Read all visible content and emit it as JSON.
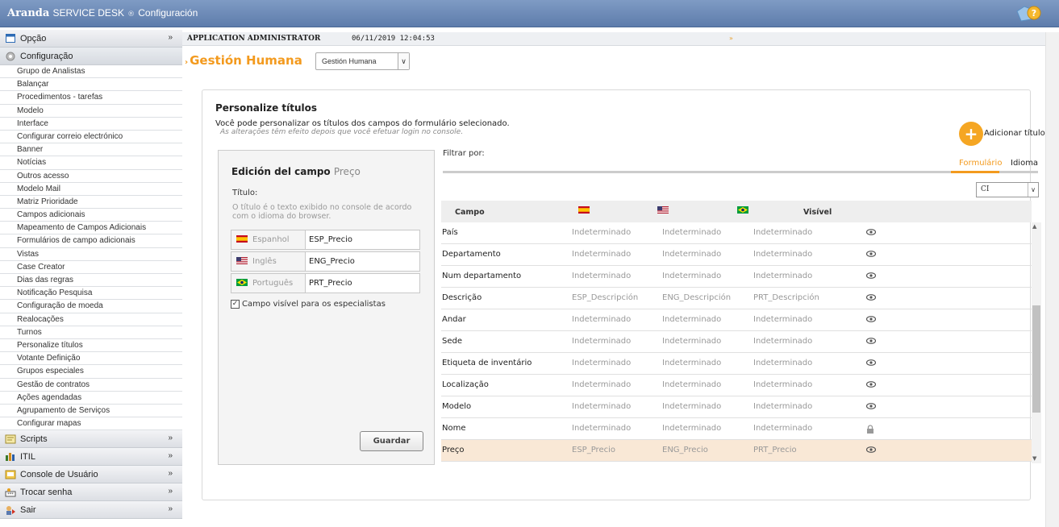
{
  "app": {
    "brand_bold": "Aranda",
    "brand_product": "SERVICE DESK",
    "brand_mark": "®",
    "brand_section": "Configuración"
  },
  "sidebar": {
    "opcao": "Opção",
    "configuracao": "Configuração",
    "items": [
      "Grupo de Analistas",
      "Balançar",
      "Procedimentos - tarefas",
      "Modelo",
      "Interface",
      "Configurar correio electrónico",
      "Banner",
      "Notícias",
      "Outros acesso",
      "Modelo Mail",
      "Matriz Prioridade",
      "Campos adicionais",
      "Mapeamento de Campos Adicionais",
      "Formulários de campo adicionais",
      "Vistas",
      "Case Creator",
      "Dias das regras",
      "Notificação Pesquisa",
      "Configuração de moeda",
      "Realocações",
      "Turnos",
      "Personalize títulos",
      "Votante Definição",
      "Grupos especiales",
      "Gestão de contratos",
      "Ações agendadas",
      "Agrupamento de Serviços",
      "Configurar mapas"
    ],
    "bottom": [
      "Scripts",
      "ITIL",
      "Console de Usuário",
      "Trocar senha",
      "Sair"
    ]
  },
  "header": {
    "user": "APPLICATION ADMINISTRATOR",
    "datetime": "06/11/2019 12:04:53",
    "arrow": "»"
  },
  "page": {
    "title_prefix": "›",
    "title": "Gestión Humana",
    "select_value": "Gestión Humana"
  },
  "card": {
    "title": "Personalize títulos",
    "desc": "Você pode personalizar os títulos dos campos do formulário selecionado.",
    "note": "As alterações têm efeito depois que você efetuar login no console."
  },
  "edit": {
    "title": "Edición del campo",
    "field": "Preço",
    "titulo_label": "Título:",
    "titulo_help": "O título é o texto exibido no console de acordo com o idioma do browser.",
    "langs": [
      {
        "name": "Espanhol",
        "value": "ESP_Precio"
      },
      {
        "name": "Inglês",
        "value": "ENG_Precio"
      },
      {
        "name": "Português",
        "value": "PRT_Precio"
      }
    ],
    "visible_label": "Campo visível para os especialistas",
    "save": "Guardar"
  },
  "filter": {
    "label": "Filtrar por:",
    "add_label": "Adicionar título",
    "tab_form": "Formulário",
    "tab_idioma": "Idioma",
    "select_value": "CI"
  },
  "table": {
    "headers": {
      "campo": "Campo",
      "visivel": "Visível"
    },
    "rows": [
      {
        "campo": "País",
        "es": "Indeterminado",
        "en": "Indeterminado",
        "pt": "Indeterminado",
        "icon": "eye",
        "mark": false,
        "sel": false
      },
      {
        "campo": "Departamento",
        "es": "Indeterminado",
        "en": "Indeterminado",
        "pt": "Indeterminado",
        "icon": "eye",
        "mark": false,
        "sel": false
      },
      {
        "campo": "Num departamento",
        "es": "Indeterminado",
        "en": "Indeterminado",
        "pt": "Indeterminado",
        "icon": "eye",
        "mark": false,
        "sel": false
      },
      {
        "campo": "Descrição",
        "es": "ESP_Descripción",
        "en": "ENG_Descripción",
        "pt": "PRT_Descripción",
        "icon": "eye",
        "mark": true,
        "sel": false
      },
      {
        "campo": "Andar",
        "es": "Indeterminado",
        "en": "Indeterminado",
        "pt": "Indeterminado",
        "icon": "eye",
        "mark": false,
        "sel": false
      },
      {
        "campo": "Sede",
        "es": "Indeterminado",
        "en": "Indeterminado",
        "pt": "Indeterminado",
        "icon": "eye",
        "mark": false,
        "sel": false
      },
      {
        "campo": "Etiqueta de inventário",
        "es": "Indeterminado",
        "en": "Indeterminado",
        "pt": "Indeterminado",
        "icon": "eye",
        "mark": false,
        "sel": false
      },
      {
        "campo": "Localização",
        "es": "Indeterminado",
        "en": "Indeterminado",
        "pt": "Indeterminado",
        "icon": "eye",
        "mark": false,
        "sel": false
      },
      {
        "campo": "Modelo",
        "es": "Indeterminado",
        "en": "Indeterminado",
        "pt": "Indeterminado",
        "icon": "eye",
        "mark": false,
        "sel": false
      },
      {
        "campo": "Nome",
        "es": "Indeterminado",
        "en": "Indeterminado",
        "pt": "Indeterminado",
        "icon": "lock",
        "mark": false,
        "sel": false
      },
      {
        "campo": "Preço",
        "es": "ESP_Precio",
        "en": "ENG_Precio",
        "pt": "PRT_Precio",
        "icon": "eye",
        "mark": true,
        "sel": true
      }
    ]
  },
  "colors": {
    "accent": "#f39a1e",
    "topbar": "#6e8cba",
    "selected_row": "#f9e8d6"
  }
}
